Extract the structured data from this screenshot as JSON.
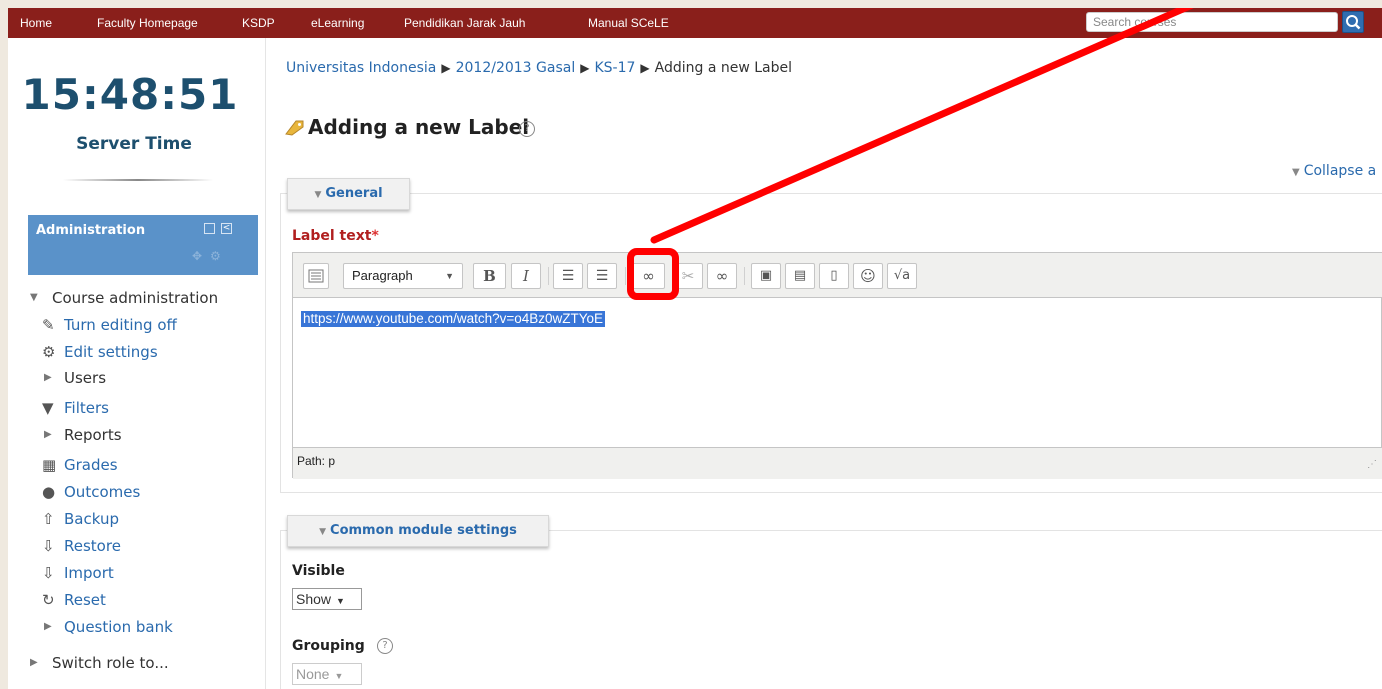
{
  "nav": {
    "items": [
      "Home",
      "Faculty Homepage",
      "KSDP",
      "eLearning",
      "Pendidikan Jarak Jauh",
      "Manual SCeLE"
    ],
    "search_placeholder": "Search courses"
  },
  "clock": {
    "time": "15:48:51",
    "label": "Server Time"
  },
  "admin": {
    "title": "Administration",
    "course_admin_label": "Course administration",
    "items": [
      {
        "label": "Turn editing off",
        "icon": "pencil-icon"
      },
      {
        "label": "Edit settings",
        "icon": "gear-icon"
      },
      {
        "label": "Users",
        "icon": "expand-triangle-icon"
      },
      {
        "label": "Filters",
        "icon": "filter-icon"
      },
      {
        "label": "Reports",
        "icon": "expand-triangle-icon"
      },
      {
        "label": "Grades",
        "icon": "grades-table-icon"
      },
      {
        "label": "Outcomes",
        "icon": "outcomes-icon"
      },
      {
        "label": "Backup",
        "icon": "backup-upload-icon"
      },
      {
        "label": "Restore",
        "icon": "restore-download-icon"
      },
      {
        "label": "Import",
        "icon": "import-icon"
      },
      {
        "label": "Reset",
        "icon": "reset-icon"
      },
      {
        "label": "Question bank",
        "icon": "expand-triangle-icon"
      }
    ],
    "switch_role": "Switch role to..."
  },
  "breadcrumb": {
    "items": [
      "Universitas Indonesia",
      "2012/2013 Gasal",
      "KS-17",
      "Adding a new Label"
    ],
    "separator": "▶"
  },
  "page": {
    "title": "Adding a new Label",
    "collapse_all": "Collapse a"
  },
  "general": {
    "legend": "General",
    "label_text": "Label text",
    "required_mark": "*",
    "editor": {
      "format_select": "Paragraph",
      "content": "https://www.youtube.com/watch?v=o4Bz0wZTYoE",
      "path": "Path: p"
    }
  },
  "common": {
    "legend": "Common module settings",
    "visible_label": "Visible",
    "visible_value": "Show",
    "grouping_label": "Grouping",
    "grouping_value": "None"
  },
  "colors": {
    "navbar": "#8a1f1b",
    "admin_header": "#5a92c9",
    "link": "#2a6aad",
    "annotation": "#ff0000",
    "selection": "#3875d7"
  }
}
